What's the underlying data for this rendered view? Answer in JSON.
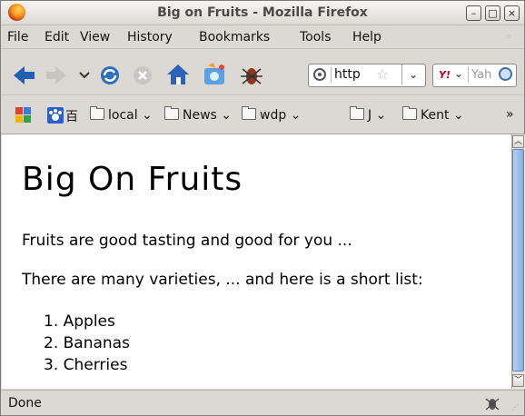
{
  "window": {
    "title": "Big on Fruits - Mozilla Firefox",
    "minimize": "–",
    "maximize": "□",
    "close": "×"
  },
  "menu": [
    {
      "label": "File"
    },
    {
      "label": "Edit"
    },
    {
      "label": "View"
    },
    {
      "label": "History"
    },
    {
      "label": "Bookmarks"
    },
    {
      "label": "Tools"
    },
    {
      "label": "Help"
    }
  ],
  "toolbar": {
    "url_text": "http",
    "url_dropdown": "⌄",
    "search_placeholder": "Yah",
    "icons": [
      "back-arrow-icon",
      "forward-arrow-icon",
      "history-dropdown-icon",
      "reload-icon",
      "stop-icon",
      "home-icon",
      "screenshot-icon",
      "bug-icon"
    ]
  },
  "bookmarks": {
    "baidu_label": "百",
    "items": [
      {
        "label": "local ⌄"
      },
      {
        "label": "News ⌄"
      },
      {
        "label": "wdp ⌄"
      },
      {
        "label": "J ⌄"
      },
      {
        "label": "Kent ⌄"
      }
    ],
    "overflow": "»"
  },
  "page": {
    "heading": "Big On Fruits",
    "para1": "Fruits are good tasting and good for you ...",
    "para2": "There are many varieties, ... and here is a short list:",
    "list": [
      "1.  Apples",
      "2.  Bananas",
      "3.  Cherries"
    ]
  },
  "status": {
    "text": "Done"
  },
  "colors": {
    "back_arrow": "#1f5fb4",
    "reload": "#2d6fbf",
    "home": "#2b63b8",
    "thumb": "#87aee0"
  }
}
